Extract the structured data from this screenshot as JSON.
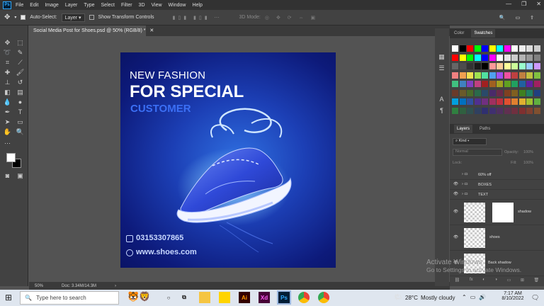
{
  "menubar": {
    "logo": "Ps",
    "items": [
      "File",
      "Edit",
      "Image",
      "Layer",
      "Type",
      "Select",
      "Filter",
      "3D",
      "View",
      "Window",
      "Help"
    ]
  },
  "options": {
    "auto_select_label": "Auto-Select:",
    "auto_select_value": "Layer",
    "transform_label": "Show Transform Controls",
    "mode_3d": "3D Mode:"
  },
  "document": {
    "tab_title": "Social Media Post for Shoes.psd @ 50% (RGB/8) *",
    "zoom": "50%",
    "doc_size": "Doc: 3.34M/14.3M"
  },
  "artwork": {
    "line1": "NEW FASHION",
    "line2": "FOR SPECIAL",
    "line3": "CUSTOMER",
    "phone": "03153307865",
    "website": "www.shoes.com",
    "colors": {
      "bg_center": "#2f6fe0",
      "bg_edge": "#0a1466",
      "accent": "#3b6ff5"
    }
  },
  "panels": {
    "color_tab": "Color",
    "swatches_tab": "Swatches",
    "layers_tab": "Layers",
    "paths_tab": "Paths",
    "kind": "Kind",
    "blend": "Normal",
    "opacity_label": "Opacity:",
    "opacity_value": "100%",
    "lock_label": "Lock:",
    "fill_label": "Fill:",
    "fill_value": "100%",
    "layers": [
      {
        "name": "60% off",
        "type": "group"
      },
      {
        "name": "BOXES",
        "type": "group"
      },
      {
        "name": "TEXT",
        "type": "group"
      },
      {
        "name": "shadow",
        "type": "thumb"
      },
      {
        "name": "shoes",
        "type": "thumb"
      },
      {
        "name": "Back shadow",
        "type": "thumb"
      }
    ]
  },
  "watermark": {
    "line1": "Activate Windows",
    "line2": "Go to Settings to activate Windows."
  },
  "taskbar": {
    "search_placeholder": "Type here to search",
    "weather_temp": "28°C",
    "weather_desc": "Mostly cloudy",
    "time": "7:17 AM",
    "date": "8/10/2022",
    "apps": [
      "file-explorer",
      "sticky-notes",
      "illustrator",
      "xd",
      "photoshop",
      "chrome",
      "chrome-alt"
    ]
  }
}
